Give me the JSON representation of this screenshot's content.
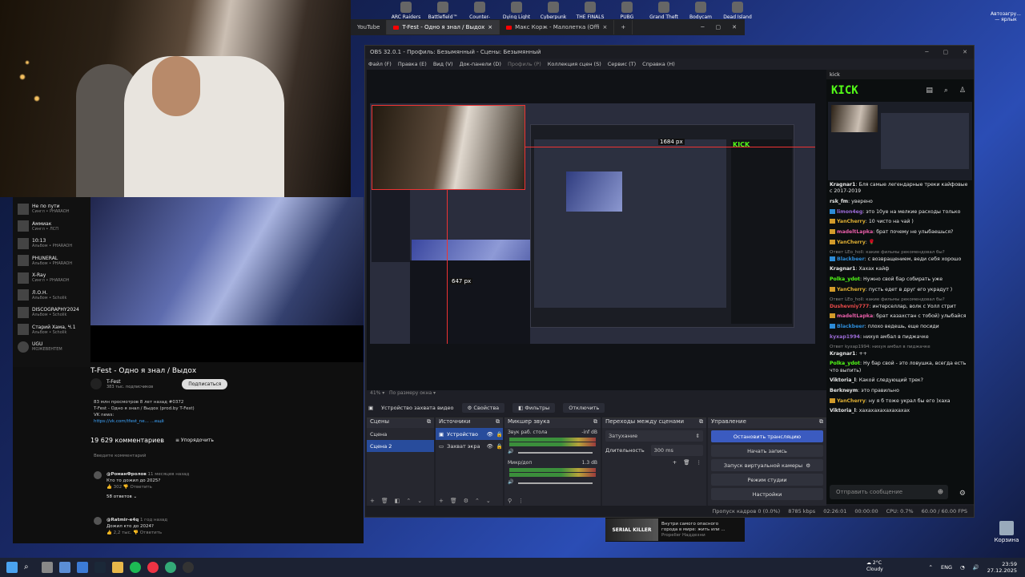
{
  "desktop": {
    "icons": [
      "ARC Raiders",
      "Battlefield™ 6",
      "Counter-Str...",
      "Dying Light",
      "Cyberpunk",
      "THE FINALS",
      "PUBG",
      "Grand Theft",
      "Bodycam",
      "Dead Island 2"
    ],
    "right_icon": "Автозагру... — ярлык",
    "trash": "Корзина"
  },
  "browser": {
    "tabs": [
      "YouTube",
      "T-Fest - Одно я знал / Выдох",
      "Макс Корж - Малолетка (Offi"
    ],
    "new_tab": "+"
  },
  "youtube": {
    "sidebar": [
      {
        "title": "Не по пути",
        "sub": "Сингл • PHARAOH"
      },
      {
        "title": "Аммиак",
        "sub": "Сингл • ЛСП"
      },
      {
        "title": "10:13",
        "sub": "Альбом • PHARAOH"
      },
      {
        "title": "PHUNERAL",
        "sub": "Альбом • PHARAOH"
      },
      {
        "title": "X-Ray",
        "sub": "Сингл • PHARAOH"
      },
      {
        "title": "Л.О.Н.",
        "sub": "Альбом • Scholik"
      },
      {
        "title": "DISCOGRAPHY2024",
        "sub": "Альбом • Scholik"
      },
      {
        "title": "Старий Хама, Ч.1",
        "sub": "Альбом • Scholik"
      },
      {
        "title": "UGU",
        "sub": "МОЖЕВЕНТЕМ"
      }
    ],
    "title": "T-Fest - Одно я знал / Выдох",
    "channel": "T-Fest",
    "subs": "383 тыс. подписчиков",
    "subscribe": "Подписаться",
    "desc_line1": "83 млн просмотров  8 лет назад  #0372",
    "desc_line2": "T-Fest - Одно я знал / Выдох (prod.by T-Fest)",
    "desc_line3": "VK news:",
    "desc_link": "https://vk.com/tfest_ne... ...ещё",
    "comments_count": "19 629 комментариев",
    "sort": "Упорядочить",
    "add_comment": "Введите комментарий",
    "comments": [
      {
        "author": "@РоманФролов",
        "time": "11 месяцев назад",
        "text": "Кто то дожил до 2025?",
        "likes": "302",
        "reply": "Ответить",
        "replies": "58 ответов"
      },
      {
        "author": "@Ratmir-e4q",
        "time": "1 год назад",
        "text": "Дожил кто до 2024?",
        "likes": "2,2 тыс.",
        "reply": "Ответить"
      }
    ]
  },
  "obs": {
    "title": "OBS 32.0.1 - Профиль: Безымянный - Сцены: Безымянный",
    "menu": [
      "Файл (F)",
      "Правка (E)",
      "Вид (V)",
      "Док-панели (D)",
      "Профиль (P)",
      "Коллекция сцен (S)",
      "Сервис (T)",
      "Справка (H)"
    ],
    "size_label_w": "1684 px",
    "size_label_h": "647 px",
    "zoom": "41%",
    "zoom_mode": "По размеру окна",
    "source_name": "Устройство захвата видео",
    "props": "Свойства",
    "filters": "Фильтры",
    "deactivate": "Отключить",
    "docks": {
      "scenes": {
        "title": "Сцены",
        "items": [
          "Сцена",
          "Сцена 2"
        ],
        "selected": 1
      },
      "sources": {
        "title": "Источники",
        "items": [
          "Устройство",
          "Захват экра"
        ]
      },
      "mixer": {
        "title": "Микшер звука",
        "ch1": "Звук раб. стола",
        "ch1_db": "-inf dB",
        "ch2": "Микр/доп",
        "ch2_db": "1.3 dB"
      },
      "transitions": {
        "title": "Переходы между сценами",
        "type": "Затухание",
        "duration_label": "Длительность",
        "duration": "300 ms"
      },
      "controls": {
        "title": "Управление",
        "stream": "Остановить трансляцию",
        "record": "Начать запись",
        "virtualcam": "Запуск виртуальной камеры",
        "studio": "Режим студии",
        "settings": "Настройки"
      }
    },
    "status": {
      "dropped": "Пропуск кадров 0 (0.0%)",
      "bitrate": "8785 kbps",
      "time1": "02:26:01",
      "time2": "00:00:00",
      "cpu": "CPU: 0.7%",
      "fps": "60.00 / 60.00 FPS"
    }
  },
  "kick": {
    "dock_title": "kick",
    "logo": "KICK",
    "input_placeholder": "Отправить сообщение",
    "messages": [
      {
        "user": "Kragnar1",
        "color": "#ffffff",
        "text": "Бля самые легендарные треки кайфовые с 2017-2019"
      },
      {
        "user": "rsk_fm",
        "color": "#ffffff",
        "text": "уверено"
      },
      {
        "user": "limon4eg",
        "color": "#9b6bd6",
        "text": "это 10уе на мелкие расходы только"
      },
      {
        "user": "YanCherry",
        "color": "#e0b034",
        "text": "10 чисто на чай )"
      },
      {
        "user": "madeltLapka",
        "color": "#e85ea8",
        "text": "брат почему не улыбаешься?"
      },
      {
        "user": "YanCherry",
        "color": "#e0b034",
        "text": "🌹"
      },
      {
        "reply": "Ответ LEo_holl: какие фильмы рекомендовал бы?",
        "user": "Blackbeer",
        "color": "#2d8bd6",
        "text": "с возвращением, веди себя хорошо"
      },
      {
        "user": "Kragnar1",
        "color": "#ffffff",
        "text": "Хахах кайф"
      },
      {
        "user": "Polka_ydot",
        "color": "#53fc18",
        "text": "Нужно свой бар собирать уже"
      },
      {
        "user": "YanCherry",
        "color": "#e0b034",
        "text": "пусть едет в друг его украдут )"
      },
      {
        "reply": "Ответ LEo_holl: какие фильмы рекомендовал бы?",
        "user": "Dushevniy777",
        "color": "#e84a4a",
        "text": "интерселлар, волк с Уолл стрит"
      },
      {
        "user": "madeltLapka",
        "color": "#e85ea8",
        "text": "брат казахстан с тобой) улыбайся"
      },
      {
        "user": "Blackbeer",
        "color": "#2d8bd6",
        "text": "плохо ведешь, еще посиди"
      },
      {
        "user": "kyxap1994",
        "color": "#9b6bd6",
        "text": "нихуя амбал в пиджачке"
      },
      {
        "reply": "Ответ kyxap1994: нихуя амбал в пиджачке",
        "user": "Kragnar1",
        "color": "#ffffff",
        "text": "++"
      },
      {
        "user": "Polka_ydot",
        "color": "#53fc18",
        "text": "Ну бар свой - это ловушка, всегда есть что выпить)"
      },
      {
        "user": "Viktoria_l",
        "color": "#ffffff",
        "text": "Какой следующий трек?"
      },
      {
        "user": "Berkneym",
        "color": "#ffffff",
        "text": "это правильно"
      },
      {
        "user": "YanCherry",
        "color": "#e0b034",
        "text": "ну я б тоже украл бы его )хаха"
      },
      {
        "user": "Viktoria_l",
        "color": "#ffffff",
        "text": "хахахахахахахахах"
      }
    ]
  },
  "ytmini": {
    "thumb": "SERIAL KILLER",
    "line1": "Внутри самого опасного",
    "line2": "города в мире: жить или ...",
    "line3": "Propeller Наддезни"
  },
  "taskbar": {
    "weather_temp": "2°C",
    "weather_text": "Cloudy",
    "lang": "ENG",
    "time": "23:59",
    "date": "27.12.2025"
  }
}
